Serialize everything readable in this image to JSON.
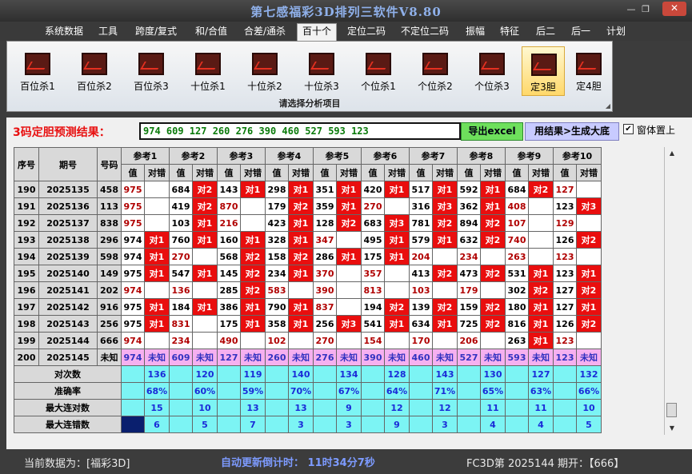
{
  "window": {
    "title": "第七感福彩3D排列三软件V8.80"
  },
  "menu": [
    "系统数据",
    "工具",
    "跨度/复式",
    "和/合值",
    "合差/通杀",
    "百十个",
    "定位二码",
    "不定位二码",
    "振幅",
    "特征",
    "后二",
    "后一",
    "计划"
  ],
  "ribbon": {
    "buttons": [
      "百位杀1",
      "百位杀2",
      "百位杀3",
      "十位杀1",
      "十位杀2",
      "十位杀3",
      "个位杀1",
      "个位杀2",
      "个位杀3",
      "定3胆",
      "定4胆"
    ],
    "footer": "请选择分析项目"
  },
  "predict": {
    "label": "3码定胆预测结果：",
    "value": "974 609 127 260 276 390 460 527 593 123",
    "export_btn": "导出excel",
    "gen_btn": "用结果>生成大底",
    "pin_label": "窗体置上",
    "pin_checked": true
  },
  "table": {
    "col_seq": "序号",
    "col_period": "期号",
    "col_num": "号码",
    "refs": [
      "参考1",
      "参考2",
      "参考3",
      "参考4",
      "参考5",
      "参考6",
      "参考7",
      "参考8",
      "参考9",
      "参考10"
    ],
    "sub_val": "值",
    "sub_dc": "对错",
    "rows": [
      {
        "seq": "190",
        "period": "2025135",
        "num": "458",
        "cells": [
          [
            "975",
            ""
          ],
          [
            "684",
            "对2"
          ],
          [
            "143",
            "对1"
          ],
          [
            "298",
            "对1"
          ],
          [
            "351",
            "对1"
          ],
          [
            "420",
            "对1"
          ],
          [
            "517",
            "对1"
          ],
          [
            "592",
            "对1"
          ],
          [
            "684",
            "对2"
          ],
          [
            "127",
            ""
          ]
        ]
      },
      {
        "seq": "191",
        "period": "2025136",
        "num": "113",
        "cells": [
          [
            "975",
            ""
          ],
          [
            "419",
            "对2"
          ],
          [
            "870",
            ""
          ],
          [
            "179",
            "对2"
          ],
          [
            "359",
            "对1"
          ],
          [
            "270",
            ""
          ],
          [
            "316",
            "对3"
          ],
          [
            "362",
            "对1"
          ],
          [
            "408",
            ""
          ],
          [
            "123",
            "对3"
          ]
        ]
      },
      {
        "seq": "192",
        "period": "2025137",
        "num": "838",
        "cells": [
          [
            "975",
            ""
          ],
          [
            "103",
            "对1"
          ],
          [
            "216",
            ""
          ],
          [
            "423",
            "对1"
          ],
          [
            "128",
            "对2"
          ],
          [
            "683",
            "对3"
          ],
          [
            "781",
            "对2"
          ],
          [
            "894",
            "对2"
          ],
          [
            "107",
            ""
          ],
          [
            "129",
            ""
          ]
        ]
      },
      {
        "seq": "193",
        "period": "2025138",
        "num": "296",
        "cells": [
          [
            "974",
            "对1"
          ],
          [
            "760",
            "对1"
          ],
          [
            "160",
            "对1"
          ],
          [
            "328",
            "对1"
          ],
          [
            "347",
            ""
          ],
          [
            "495",
            "对1"
          ],
          [
            "579",
            "对1"
          ],
          [
            "632",
            "对2"
          ],
          [
            "740",
            ""
          ],
          [
            "126",
            "对2"
          ]
        ]
      },
      {
        "seq": "194",
        "period": "2025139",
        "num": "598",
        "cells": [
          [
            "974",
            "对1"
          ],
          [
            "270",
            ""
          ],
          [
            "568",
            "对2"
          ],
          [
            "158",
            "对2"
          ],
          [
            "286",
            "对1"
          ],
          [
            "175",
            "对1"
          ],
          [
            "204",
            ""
          ],
          [
            "234",
            ""
          ],
          [
            "263",
            ""
          ],
          [
            "123",
            ""
          ]
        ]
      },
      {
        "seq": "195",
        "period": "2025140",
        "num": "149",
        "cells": [
          [
            "975",
            "对1"
          ],
          [
            "547",
            "对1"
          ],
          [
            "145",
            "对2"
          ],
          [
            "234",
            "对1"
          ],
          [
            "370",
            ""
          ],
          [
            "357",
            ""
          ],
          [
            "413",
            "对2"
          ],
          [
            "473",
            "对2"
          ],
          [
            "531",
            "对1"
          ],
          [
            "123",
            "对1"
          ]
        ]
      },
      {
        "seq": "196",
        "period": "2025141",
        "num": "202",
        "cells": [
          [
            "974",
            ""
          ],
          [
            "136",
            ""
          ],
          [
            "285",
            "对2"
          ],
          [
            "583",
            ""
          ],
          [
            "390",
            ""
          ],
          [
            "813",
            ""
          ],
          [
            "103",
            ""
          ],
          [
            "179",
            ""
          ],
          [
            "302",
            "对2"
          ],
          [
            "127",
            "对2"
          ]
        ]
      },
      {
        "seq": "197",
        "period": "2025142",
        "num": "916",
        "cells": [
          [
            "975",
            "对1"
          ],
          [
            "184",
            "对1"
          ],
          [
            "386",
            "对1"
          ],
          [
            "790",
            "对1"
          ],
          [
            "837",
            ""
          ],
          [
            "194",
            "对2"
          ],
          [
            "139",
            "对2"
          ],
          [
            "159",
            "对2"
          ],
          [
            "180",
            "对1"
          ],
          [
            "127",
            "对1"
          ]
        ]
      },
      {
        "seq": "198",
        "period": "2025143",
        "num": "256",
        "cells": [
          [
            "975",
            "对1"
          ],
          [
            "831",
            ""
          ],
          [
            "175",
            "对1"
          ],
          [
            "358",
            "对1"
          ],
          [
            "256",
            "对3"
          ],
          [
            "541",
            "对1"
          ],
          [
            "634",
            "对1"
          ],
          [
            "725",
            "对2"
          ],
          [
            "816",
            "对1"
          ],
          [
            "126",
            "对2"
          ]
        ]
      },
      {
        "seq": "199",
        "period": "2025144",
        "num": "666",
        "cells": [
          [
            "974",
            ""
          ],
          [
            "234",
            ""
          ],
          [
            "490",
            ""
          ],
          [
            "102",
            ""
          ],
          [
            "270",
            ""
          ],
          [
            "154",
            ""
          ],
          [
            "170",
            ""
          ],
          [
            "206",
            ""
          ],
          [
            "263",
            "对1"
          ],
          [
            "123",
            ""
          ]
        ]
      }
    ],
    "forecast": {
      "seq": "200",
      "period": "2025145",
      "num": "未知",
      "unknown": "未知",
      "values": [
        "974",
        "609",
        "127",
        "260",
        "276",
        "390",
        "460",
        "527",
        "593",
        "123"
      ]
    },
    "stats": [
      {
        "label": "对次数",
        "values": [
          "136",
          "120",
          "119",
          "140",
          "134",
          "128",
          "143",
          "130",
          "127",
          "132"
        ]
      },
      {
        "label": "准确率",
        "values": [
          "68%",
          "60%",
          "59%",
          "70%",
          "67%",
          "64%",
          "71%",
          "65%",
          "63%",
          "66%"
        ]
      },
      {
        "label": "最大连对数",
        "values": [
          "15",
          "10",
          "13",
          "13",
          "9",
          "12",
          "12",
          "11",
          "11",
          "10"
        ]
      },
      {
        "label": "最大连错数",
        "values": [
          "6",
          "5",
          "7",
          "3",
          "3",
          "9",
          "3",
          "4",
          "4",
          "5"
        ]
      }
    ]
  },
  "status": {
    "current": "当前数据为：[福彩3D]",
    "countdown": "自动更新倒计时： 11时34分7秒",
    "period": "FC3D第 2025144 期开：【666】"
  }
}
